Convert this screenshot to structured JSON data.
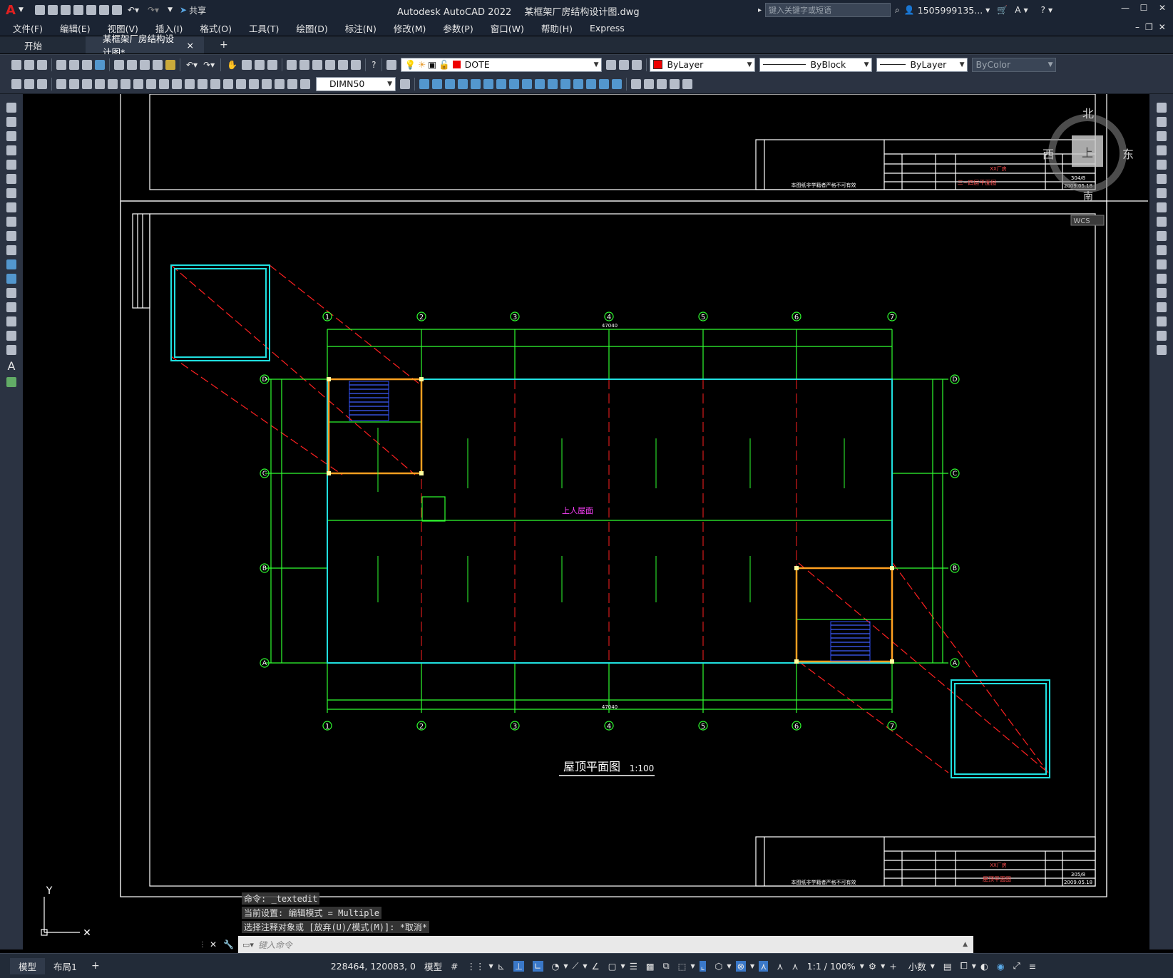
{
  "app": {
    "title": "Autodesk AutoCAD 2022",
    "filename": "某框架厂房结构设计图.dwg",
    "share_label": "共享",
    "search_placeholder": "键入关键字或短语",
    "user": "1505999135...",
    "help_icon": "question-icon"
  },
  "menu": [
    "文件(F)",
    "编辑(E)",
    "视图(V)",
    "插入(I)",
    "格式(O)",
    "工具(T)",
    "绘图(D)",
    "标注(N)",
    "修改(M)",
    "参数(P)",
    "窗口(W)",
    "帮助(H)",
    "Express"
  ],
  "tabs": {
    "start": "开始",
    "document": "某框架厂房结构设计图*",
    "close": "×",
    "add": "+"
  },
  "toolbar": {
    "layer": "DOTE",
    "color": "ByLayer",
    "linetype": "ByBlock",
    "lineweight": "ByLayer",
    "plotstyle": "ByColor",
    "dimstyle": "DIMN50"
  },
  "viewcube": {
    "north": "北",
    "south": "南",
    "east": "东",
    "west": "西",
    "face": "上",
    "wcs": "WCS"
  },
  "drawing": {
    "title": "屋顶平面图",
    "scale": "1:100",
    "roof_label": "上人屋面",
    "axes_top": [
      "1",
      "2",
      "3",
      "4",
      "5",
      "6",
      "7"
    ],
    "axes_side": [
      "D",
      "C",
      "B",
      "A"
    ],
    "axes_bottom": [
      "1",
      "2",
      "3",
      "4",
      "5",
      "6",
      "7"
    ],
    "total_dim": "47040",
    "titleblock_upper": "三~四层平面图",
    "titleblock_lower": "屋顶平面图",
    "titleblock_project": "XX厂房",
    "titleblock_date_upper": "2009.05.18",
    "titleblock_date_lower": "2009.05.18",
    "titleblock_no_upper": "304/8",
    "titleblock_no_lower": "305/8",
    "titleblock_footer": "本图纸非学籍者严格不可有效",
    "ucs_y": "Y"
  },
  "command": {
    "history": [
      "命令: _textedit",
      "当前设置: 编辑模式 = Multiple",
      "选择注释对象或 [放弃(U)/模式(M)]: *取消*"
    ],
    "placeholder": "键入命令"
  },
  "status": {
    "model_tab": "模型",
    "layout_tab": "布局1",
    "add_tab": "+",
    "coords": "228464, 120083, 0",
    "model": "模型",
    "scale": "1:1 / 100%",
    "units": "小数"
  }
}
